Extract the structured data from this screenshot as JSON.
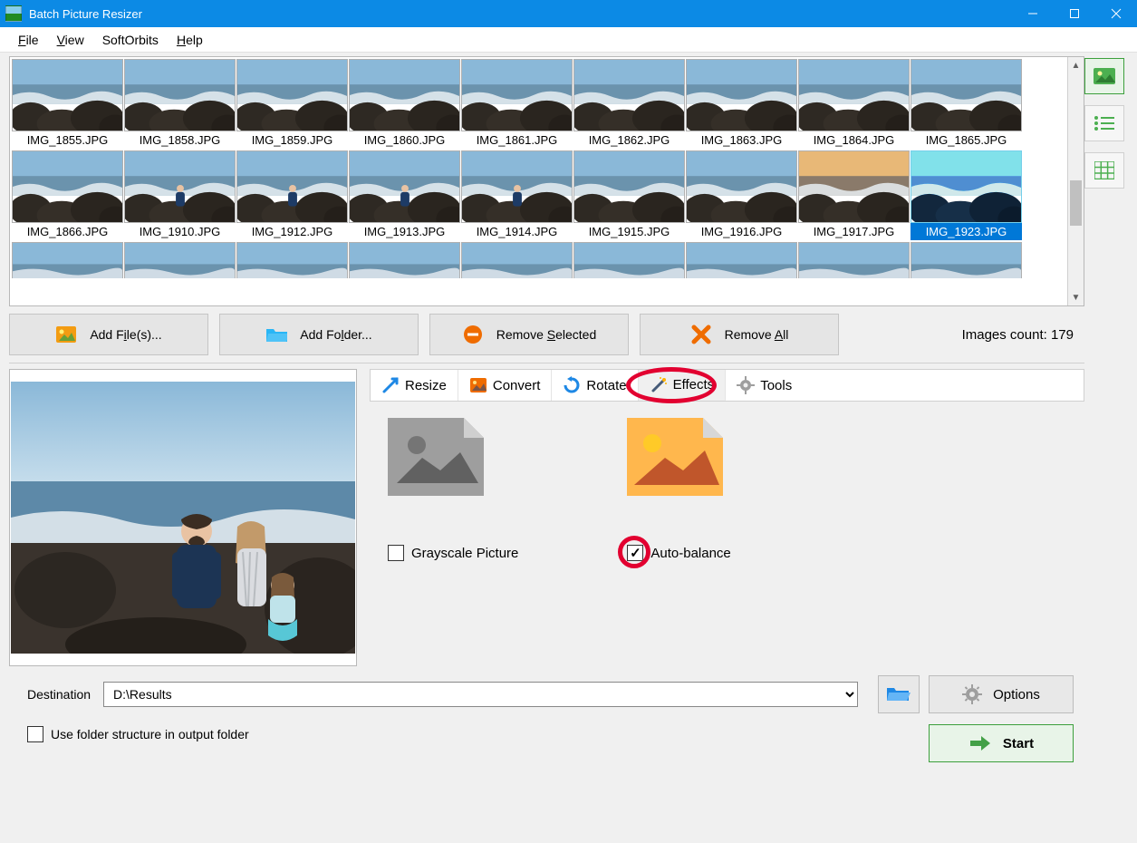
{
  "title": "Batch Picture Resizer",
  "menu": {
    "file_html": "<u>F</u>ile",
    "view_html": "<u>V</u>iew",
    "softorbits": "SoftOrbits",
    "help_html": "<u>H</u>elp"
  },
  "gallery": {
    "row1": [
      "IMG_1855.JPG",
      "IMG_1858.JPG",
      "IMG_1859.JPG",
      "IMG_1860.JPG",
      "IMG_1861.JPG",
      "IMG_1862.JPG",
      "IMG_1863.JPG",
      "IMG_1864.JPG",
      "IMG_1865.JPG"
    ],
    "row2": [
      "IMG_1866.JPG",
      "IMG_1910.JPG",
      "IMG_1912.JPG",
      "IMG_1913.JPG",
      "IMG_1914.JPG",
      "IMG_1915.JPG",
      "IMG_1916.JPG",
      "IMG_1917.JPG",
      "IMG_1923.JPG"
    ],
    "selected": "IMG_1923.JPG"
  },
  "toolbar": {
    "add_files_html": "Add F<u>i</u>le(s)...",
    "add_folder_html": "Add Fo<u>l</u>der...",
    "remove_selected_html": "Remove <u>S</u>elected",
    "remove_all_html": "Remove <u>A</u>ll",
    "images_count_label": "Images count:",
    "images_count": "179"
  },
  "tabs": {
    "resize": "Resize",
    "convert": "Convert",
    "rotate": "Rotate",
    "effects": "Effects",
    "tools": "Tools",
    "active": "Effects"
  },
  "effects": {
    "grayscale_label": "Grayscale Picture",
    "grayscale_checked": false,
    "auto_balance_label": "Auto-balance",
    "auto_balance_checked": true
  },
  "destination": {
    "label": "Destination",
    "value": "D:\\Results",
    "folder_structure_label": "Use folder structure in output folder",
    "folder_structure_checked": false
  },
  "buttons": {
    "options": "Options",
    "start": "Start"
  }
}
